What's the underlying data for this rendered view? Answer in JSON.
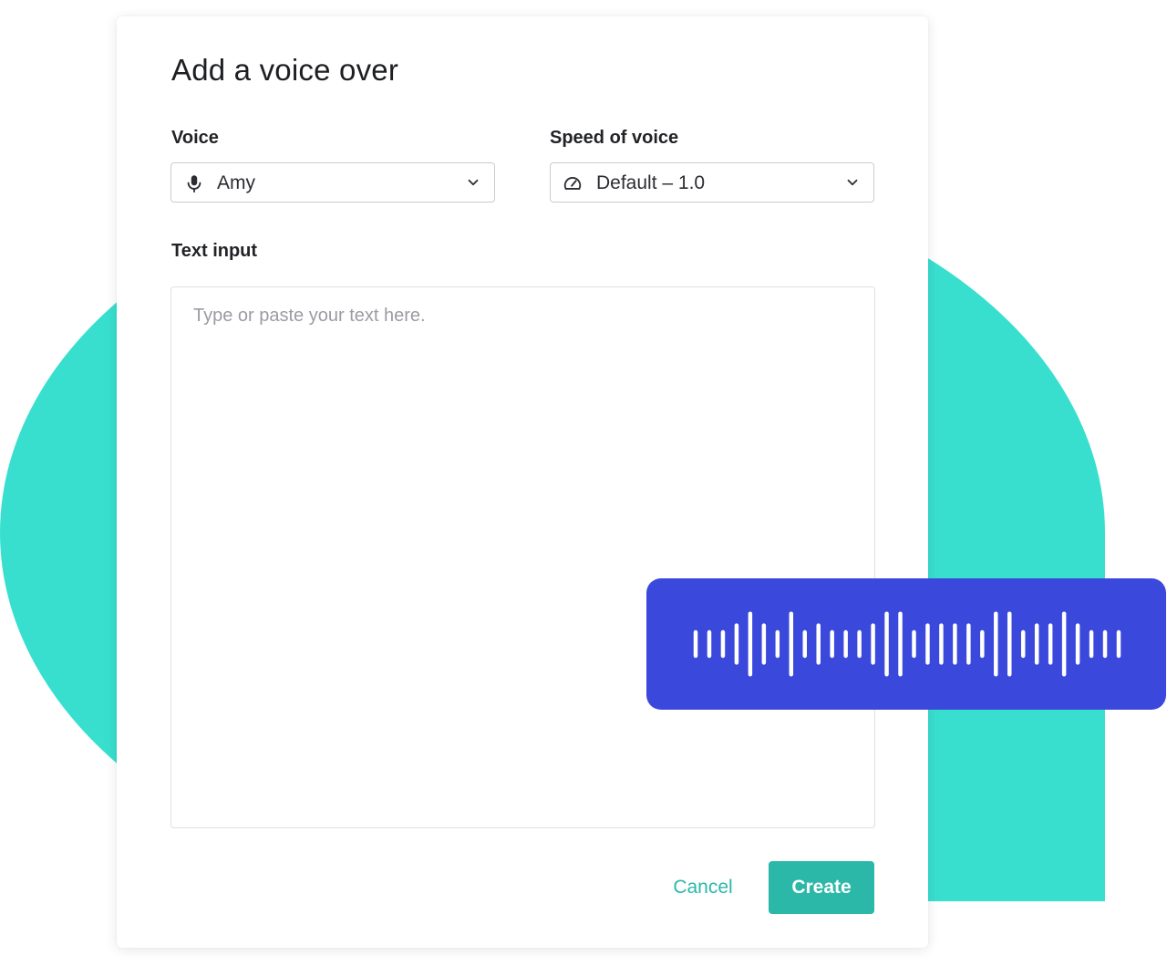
{
  "dialog": {
    "title": "Add a voice over",
    "voice": {
      "label": "Voice",
      "selected": "Amy",
      "icon": "microphone-icon"
    },
    "speed": {
      "label": "Speed of voice",
      "selected": "Default – 1.0",
      "icon": "speedometer-icon"
    },
    "text_input": {
      "label": "Text input",
      "placeholder": "Type or paste your text here.",
      "value": ""
    },
    "buttons": {
      "cancel": "Cancel",
      "create": "Create"
    }
  },
  "colors": {
    "accent": "#2bb8a8",
    "background_shape": "#38dfcf",
    "waveform_card": "#3a49dc"
  },
  "waveform": {
    "icon": "audio-waveform",
    "bar_levels": [
      0.35,
      0.35,
      0.35,
      0.55,
      0.9,
      0.55,
      0.35,
      0.9,
      0.35,
      0.55,
      0.35,
      0.35,
      0.35,
      0.55,
      0.9,
      0.9,
      0.35,
      0.55,
      0.55,
      0.55,
      0.55,
      0.35,
      0.9,
      0.9,
      0.35,
      0.55,
      0.55,
      0.9,
      0.55,
      0.35,
      0.35,
      0.35
    ]
  }
}
